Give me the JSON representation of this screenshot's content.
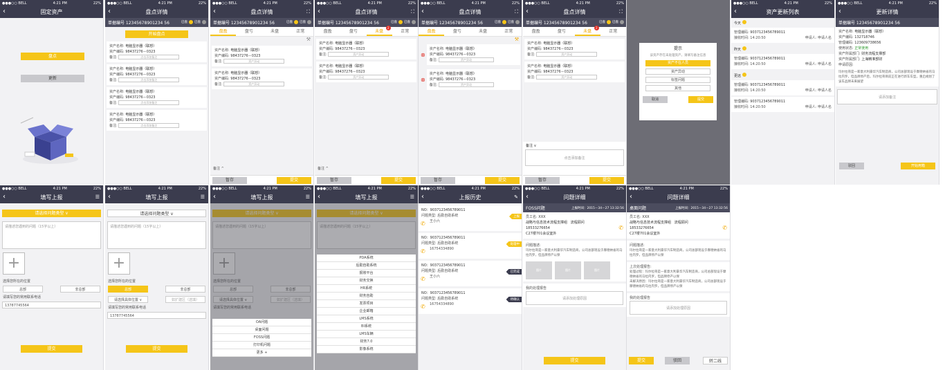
{
  "status": {
    "carrier": "●●●○○ BELL",
    "wifi": "◠",
    "time": "4:21 PM",
    "bt": "✱",
    "battery": "22%"
  },
  "s1": {
    "title": "固定资产",
    "btn_inventory": "盘点",
    "btn_update": "更新"
  },
  "s2": {
    "title": "盘点详情",
    "doc": "单据编号 12345678901234 56",
    "start_btn": "开始盘点",
    "cards": [
      {
        "name_label": "资产名称:",
        "name": "电脑显示器（联想）",
        "code_label": "资产编码:",
        "code": "98437276－0323",
        "remark_label": "备注:",
        "remark_ph": "点击添加备注"
      },
      {
        "name_label": "资产名称:",
        "name": "电脑显示器（联想）",
        "code_label": "资产编码:",
        "code": "98437276－0323",
        "remark_label": "备注:",
        "remark_ph": "点击添加备注"
      },
      {
        "name_label": "资产名称:",
        "name": "电脑显示器（联想）",
        "code_label": "资产编码:",
        "code": "98437276－0323",
        "remark_label": "备注:",
        "remark_ph": "点击添加备注"
      },
      {
        "name_label": "资产名称:",
        "name": "电脑显示器（联想）",
        "code_label": "资产编码:",
        "code": "98437276－0323",
        "remark_label": "备注:",
        "remark_ph": "点击添加备注"
      }
    ]
  },
  "legend": {
    "done": "已盘",
    "undone": "已盘"
  },
  "doc_no": "单据编号 12345678901234 56",
  "tabs": [
    "盘盈",
    "盘亏",
    "未盘",
    "正常"
  ],
  "detail": {
    "title": "盘点详情",
    "name_label": "资产名称:",
    "name": "电脑显示器（联想）",
    "code_label": "资产编码:",
    "code": "98437276－0323",
    "remark_label": "备注:",
    "remark_val": "资产异动",
    "remark_section": "备注",
    "remark_add": "点击添加备注",
    "save": "暂存",
    "submit": "提交"
  },
  "dialog": {
    "title": "提示",
    "msg": "该资产存在未处理资产，请填写备注信息",
    "options": [
      "资产不在人员",
      "资产异动",
      "标签问题",
      "其他"
    ],
    "cancel": "取消",
    "confirm": "提交"
  },
  "updates": {
    "title": "资产更新列表",
    "groups": [
      {
        "label": "今天",
        "code_label": "管理编码:",
        "code": "9037123456789011",
        "time_label": "接收时间:",
        "time": "14:20:50",
        "applicant": "申请人:",
        "applicant_val": "申请人名"
      },
      {
        "label": "昨天",
        "code_label": "管理编码:",
        "code": "9037123456789011",
        "time_label": "接收时间:",
        "time": "14:20:50",
        "applicant": "申请人:",
        "applicant_val": "申请人名"
      },
      {
        "label": "更远",
        "code_label": "管理编码:",
        "code": "9037123456789011",
        "time_label": "接收时间:",
        "time": "14:20:50",
        "applicant": "申请人:",
        "applicant_val": "申请人名"
      },
      {
        "label": "",
        "code_label": "管理编码:",
        "code": "9037123456789011",
        "time_label": "接收时间:",
        "time": "14:20:50",
        "applicant": "申请人:",
        "applicant_val": "申请人名"
      }
    ]
  },
  "update_detail": {
    "title": "更新详情",
    "doc": "单据编号 12345678901234 56",
    "rows": [
      [
        "资产名称:",
        "电脑显示器（联想）"
      ],
      [
        "资产编码:",
        "132718746"
      ],
      [
        "管理编码:",
        "123609738656"
      ],
      [
        "使用状态:",
        "正常使用"
      ],
      [
        "资产所属部门:",
        "财务流程支撑部"
      ],
      [
        "资产所属部门:",
        "上海精准部财"
      ],
      [
        "申请原因:",
        ""
      ]
    ],
    "reason": "玛尔拉哥是一家意大利豪华汽车制造商，公司总部现设于摩德纳省的马拉内罗，但品牌停产后，玛尔拉哥目前正在进行新车车型，重启规划了该车品牌未来展望",
    "remark_ph": "请添加备注",
    "back": "驳回",
    "approve": "开始用箱"
  },
  "report": {
    "title": "填写上报",
    "type_btn": "请选择问题类型",
    "textarea_ph": "请描述您遇到的问题（15字以上）",
    "loc_label": "选择您所在的位置",
    "btn_head": "总部",
    "btn_branch": "非总部",
    "contact_label": "请填写您的常用联系电话",
    "phone": "13787745564",
    "submit": "提交",
    "loc_select": "请选择具体位置",
    "detail_ph": "如扩建区（选填）"
  },
  "sheet1": [
    "OA问题",
    "桌面问题",
    "FOSS问题",
    "打印机问题",
    "更多 +"
  ],
  "sheet2": [
    "PDA系统",
    "后勤自助系统",
    "报账平台",
    "财务交换",
    "HR系统",
    "财务自助",
    "发票项目",
    "企业邮箱",
    "LMS系统",
    "BI系统",
    "LMS车辆",
    "财务7.0",
    "影像系统"
  ],
  "history": {
    "title": "上报历史",
    "items": [
      {
        "no": "NO：9037123456789011",
        "type_label": "问题类型:",
        "type": "后勤自助系统",
        "person": "王小六",
        "status": "上报",
        "color": "#f5c518"
      },
      {
        "no": "NO：9037123456789011",
        "type_label": "问题类型:",
        "type": "后勤自助系统",
        "person": "16754334890",
        "status": "处理中",
        "color": "#f5c518"
      },
      {
        "no": "NO：9037123456789011",
        "type_label": "问题类型:",
        "type": "后勤自助系统",
        "person": "王小六",
        "status": "已完成",
        "color": "#3b3c4e"
      },
      {
        "no": "NO：9037123456789011",
        "type_label": "问题类型:",
        "type": "后勤自助系统",
        "person": "16754334890",
        "status": "待确认",
        "color": "#3b3c4e"
      }
    ]
  },
  "issue1": {
    "title": "问题详细",
    "category": "FOSS问题",
    "time": "上报时间：2015－34－27 13:32:56",
    "staff_label": "员工名:",
    "staff": "XXX",
    "dept": "战略与信息技术流程支撑组",
    "dept2": "流程顾问",
    "phone": "18533276654",
    "room": "C27楼701会议室外",
    "desc_label": "问题描述:",
    "desc": "玛尔拉哥是一家意大利豪华汽车制造商，公司总部现设于摩德纳省的马拉内罗，但品牌停产以保",
    "images": [
      "图片",
      "图片",
      "图片"
    ],
    "my_label": "我的处理报告",
    "my_ph": "请添加处理原因",
    "submit": "提交"
  },
  "issue2": {
    "title": "问题详细",
    "category": "桌面问题",
    "time": "上报时间：2015－34－27 13:32:56",
    "staff_label": "员工名:",
    "staff": "XXX",
    "dept": "战略与信息技术流程支撑组",
    "dept2": "流程顾问",
    "phone": "18533276654",
    "room": "C27楼701会议室外",
    "desc_label": "问题描述:",
    "desc": "玛尔拉哥是一家意大利豪华汽车制造商，公司总部现设于摩德纳省的马拉内罗，但品牌停产以保",
    "prev_label": "上次处理报告:",
    "prev1": "处理过程：玛尔拉哥是一家意大利豪华汽车制造商，公司总部现设于摩德纳省的马拉内罗，但品牌停产以保",
    "prev2": "未解决原因：玛尔拉哥是一家意大利豪华汽车制造商，公司总部现设于摩德纳省的马拉内罗，但品牌停产以保",
    "my_label": "我的处理报告",
    "my_ph": "请添加处理原因",
    "submit": "提交",
    "reject": "驳回",
    "second": "转二线"
  }
}
